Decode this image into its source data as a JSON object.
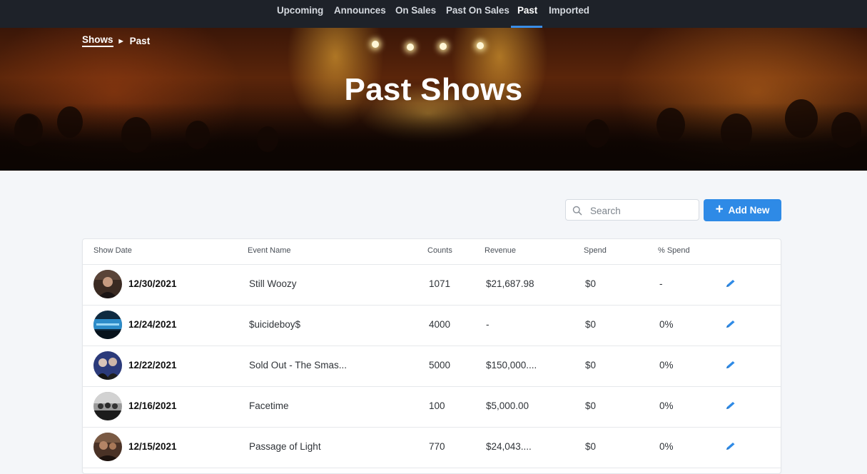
{
  "nav": {
    "tabs": [
      {
        "label": "Upcoming",
        "active": false
      },
      {
        "label": "Announces",
        "active": false
      },
      {
        "label": "On Sales",
        "active": false
      },
      {
        "label": "Past On Sales",
        "active": false
      },
      {
        "label": "Past",
        "active": true
      },
      {
        "label": "Imported",
        "active": false
      }
    ],
    "accent_color": "#3a8de6"
  },
  "hero": {
    "breadcrumb": [
      {
        "label": "Shows"
      },
      {
        "label": "Past"
      }
    ],
    "title": "Past Shows"
  },
  "toolbar": {
    "search_placeholder": "Search",
    "search_value": "",
    "add_label": "Add New",
    "add_color": "#2e8ae6"
  },
  "table": {
    "columns": [
      "Show Date",
      "Event Name",
      "Counts",
      "Revenue",
      "Spend",
      "% Spend"
    ],
    "rows": [
      {
        "date": "12/30/2021",
        "event": "Still Woozy",
        "counts": "1071",
        "revenue": "$21,687.98",
        "spend": "$0",
        "pct_spend": "-",
        "avatar": "dark-portrait",
        "edit_icon": "pencil-icon"
      },
      {
        "date": "12/24/2021",
        "event": "$uicideboy$",
        "counts": "4000",
        "revenue": "-",
        "spend": "$0",
        "pct_spend": "0%",
        "avatar": "blue-stage",
        "edit_icon": "pencil-icon"
      },
      {
        "date": "12/22/2021",
        "event": "Sold Out - The Smas...",
        "counts": "5000",
        "revenue": "$150,000....",
        "spend": "$0",
        "pct_spend": "0%",
        "avatar": "band-photo",
        "edit_icon": "pencil-icon"
      },
      {
        "date": "12/16/2021",
        "event": "Facetime",
        "counts": "100",
        "revenue": "$5,000.00",
        "spend": "$0",
        "pct_spend": "0%",
        "avatar": "grey-group",
        "edit_icon": "pencil-icon"
      },
      {
        "date": "12/15/2021",
        "event": "Passage of Light",
        "counts": "770",
        "revenue": "$24,043....",
        "spend": "$0",
        "pct_spend": "0%",
        "avatar": "warm-portrait",
        "edit_icon": "pencil-icon"
      }
    ]
  }
}
